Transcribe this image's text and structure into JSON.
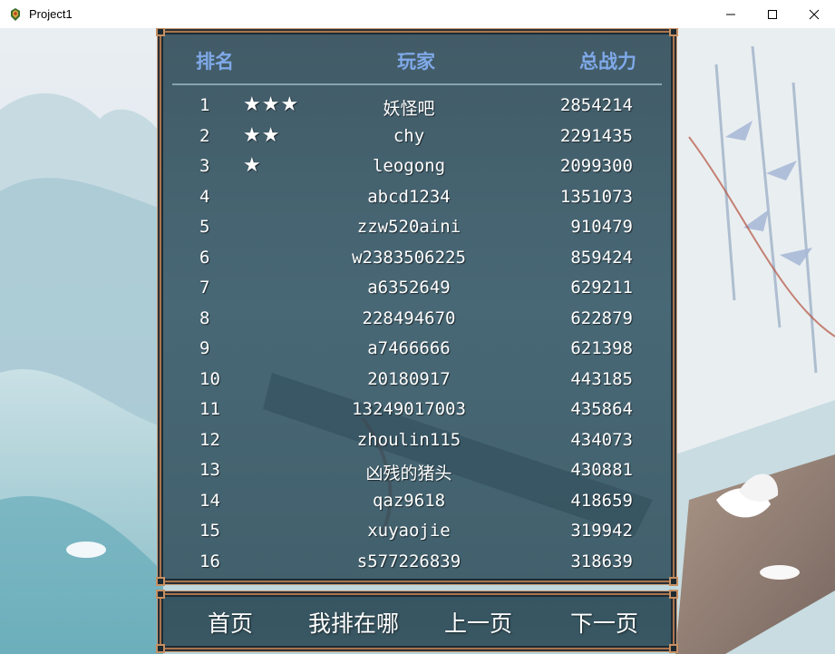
{
  "window": {
    "title": "Project1"
  },
  "ranking": {
    "headers": {
      "rank": "排名",
      "player": "玩家",
      "power": "总战力"
    },
    "rows": [
      {
        "rank": "1",
        "stars": "★★★",
        "name": "妖怪吧",
        "power": "2854214"
      },
      {
        "rank": "2",
        "stars": "★★",
        "name": "chy",
        "power": "2291435"
      },
      {
        "rank": "3",
        "stars": "★",
        "name": "leogong",
        "power": "2099300"
      },
      {
        "rank": "4",
        "stars": "",
        "name": "abcd1234",
        "power": "1351073"
      },
      {
        "rank": "5",
        "stars": "",
        "name": "zzw520aini",
        "power": "910479"
      },
      {
        "rank": "6",
        "stars": "",
        "name": "w2383506225",
        "power": "859424"
      },
      {
        "rank": "7",
        "stars": "",
        "name": "a6352649",
        "power": "629211"
      },
      {
        "rank": "8",
        "stars": "",
        "name": "228494670",
        "power": "622879"
      },
      {
        "rank": "9",
        "stars": "",
        "name": "a7466666",
        "power": "621398"
      },
      {
        "rank": "10",
        "stars": "",
        "name": "20180917",
        "power": "443185"
      },
      {
        "rank": "11",
        "stars": "",
        "name": "13249017003",
        "power": "435864"
      },
      {
        "rank": "12",
        "stars": "",
        "name": "zhoulin115",
        "power": "434073"
      },
      {
        "rank": "13",
        "stars": "",
        "name": "凶残的猪头",
        "power": "430881"
      },
      {
        "rank": "14",
        "stars": "",
        "name": "qaz9618",
        "power": "418659"
      },
      {
        "rank": "15",
        "stars": "",
        "name": "xuyaojie",
        "power": "319942"
      },
      {
        "rank": "16",
        "stars": "",
        "name": "s577226839",
        "power": "318639"
      }
    ]
  },
  "buttons": {
    "first": "首页",
    "mine": "我排在哪",
    "prev": "上一页",
    "next": "下一页"
  },
  "colors": {
    "header_text": "#7fa9e8",
    "panel_border": "#a9744d",
    "row_text": "#ffffff"
  }
}
